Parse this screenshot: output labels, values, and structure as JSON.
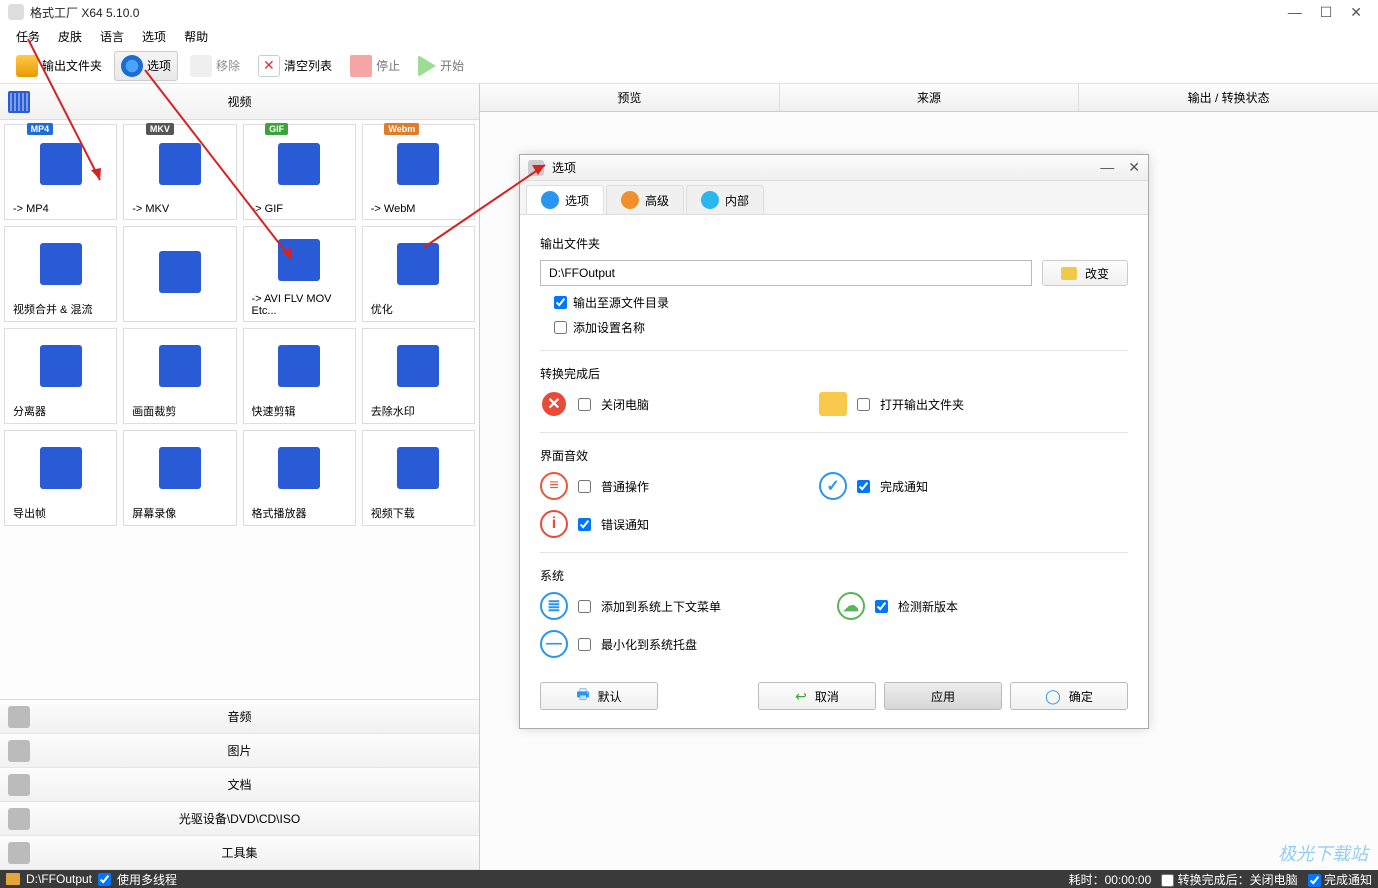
{
  "window": {
    "title": "格式工厂 X64 5.10.0"
  },
  "menu": {
    "items": [
      "任务",
      "皮肤",
      "语言",
      "选项",
      "帮助"
    ]
  },
  "toolbar": {
    "output_folder": "输出文件夹",
    "options": "选项",
    "remove": "移除",
    "clear": "清空列表",
    "stop": "停止",
    "start": "开始"
  },
  "left": {
    "video_header": "视频",
    "grid": [
      {
        "label": "-> MP4",
        "badge": "MP4",
        "badge_cls": "bd-mp4"
      },
      {
        "label": "-> MKV",
        "badge": "MKV",
        "badge_cls": "bd-mkv"
      },
      {
        "label": "-> GIF",
        "badge": "GIF",
        "badge_cls": "bd-gif"
      },
      {
        "label": "-> WebM",
        "badge": "Webm",
        "badge_cls": "bd-webm"
      },
      {
        "label": "视频合并 & 混流"
      },
      {
        "label": ""
      },
      {
        "label": "-> AVI FLV MOV Etc..."
      },
      {
        "label": "优化"
      },
      {
        "label": "分离器"
      },
      {
        "label": "画面裁剪"
      },
      {
        "label": "快速剪辑"
      },
      {
        "label": "去除水印"
      },
      {
        "label": "导出帧"
      },
      {
        "label": "屏幕录像"
      },
      {
        "label": "格式播放器"
      },
      {
        "label": "视频下载"
      }
    ],
    "cats": [
      "音频",
      "图片",
      "文档",
      "光驱设备\\DVD\\CD\\ISO",
      "工具集"
    ]
  },
  "right": {
    "cols": [
      "预览",
      "来源",
      "输出 / 转换状态"
    ]
  },
  "dialog": {
    "title": "选项",
    "tabs": [
      "选项",
      "高级",
      "内部"
    ],
    "output_section": "输出文件夹",
    "output_path": "D:\\FFOutput",
    "change": "改变",
    "chk_output_src": "输出至源文件目录",
    "chk_add_name": "添加设置名称",
    "convert_done_section": "转换完成后",
    "opt_shutdown": "关闭电脑",
    "opt_open_output": "打开输出文件夹",
    "sound_section": "界面音效",
    "opt_normal": "普通操作",
    "opt_done_notify": "完成通知",
    "opt_error_notify": "错误通知",
    "system_section": "系统",
    "opt_context_menu": "添加到系统上下文菜单",
    "opt_check_update": "检测新版本",
    "opt_minimize_tray": "最小化到系统托盘",
    "btn_default": "默认",
    "btn_cancel": "取消",
    "btn_apply": "应用",
    "btn_ok": "确定"
  },
  "status": {
    "path": "D:\\FFOutput",
    "multithread": "使用多线程",
    "elapsed": "耗时：00:00:00",
    "after": "转换完成后：关闭电脑",
    "done_notify": "完成通知"
  },
  "watermark": "极光下载站"
}
